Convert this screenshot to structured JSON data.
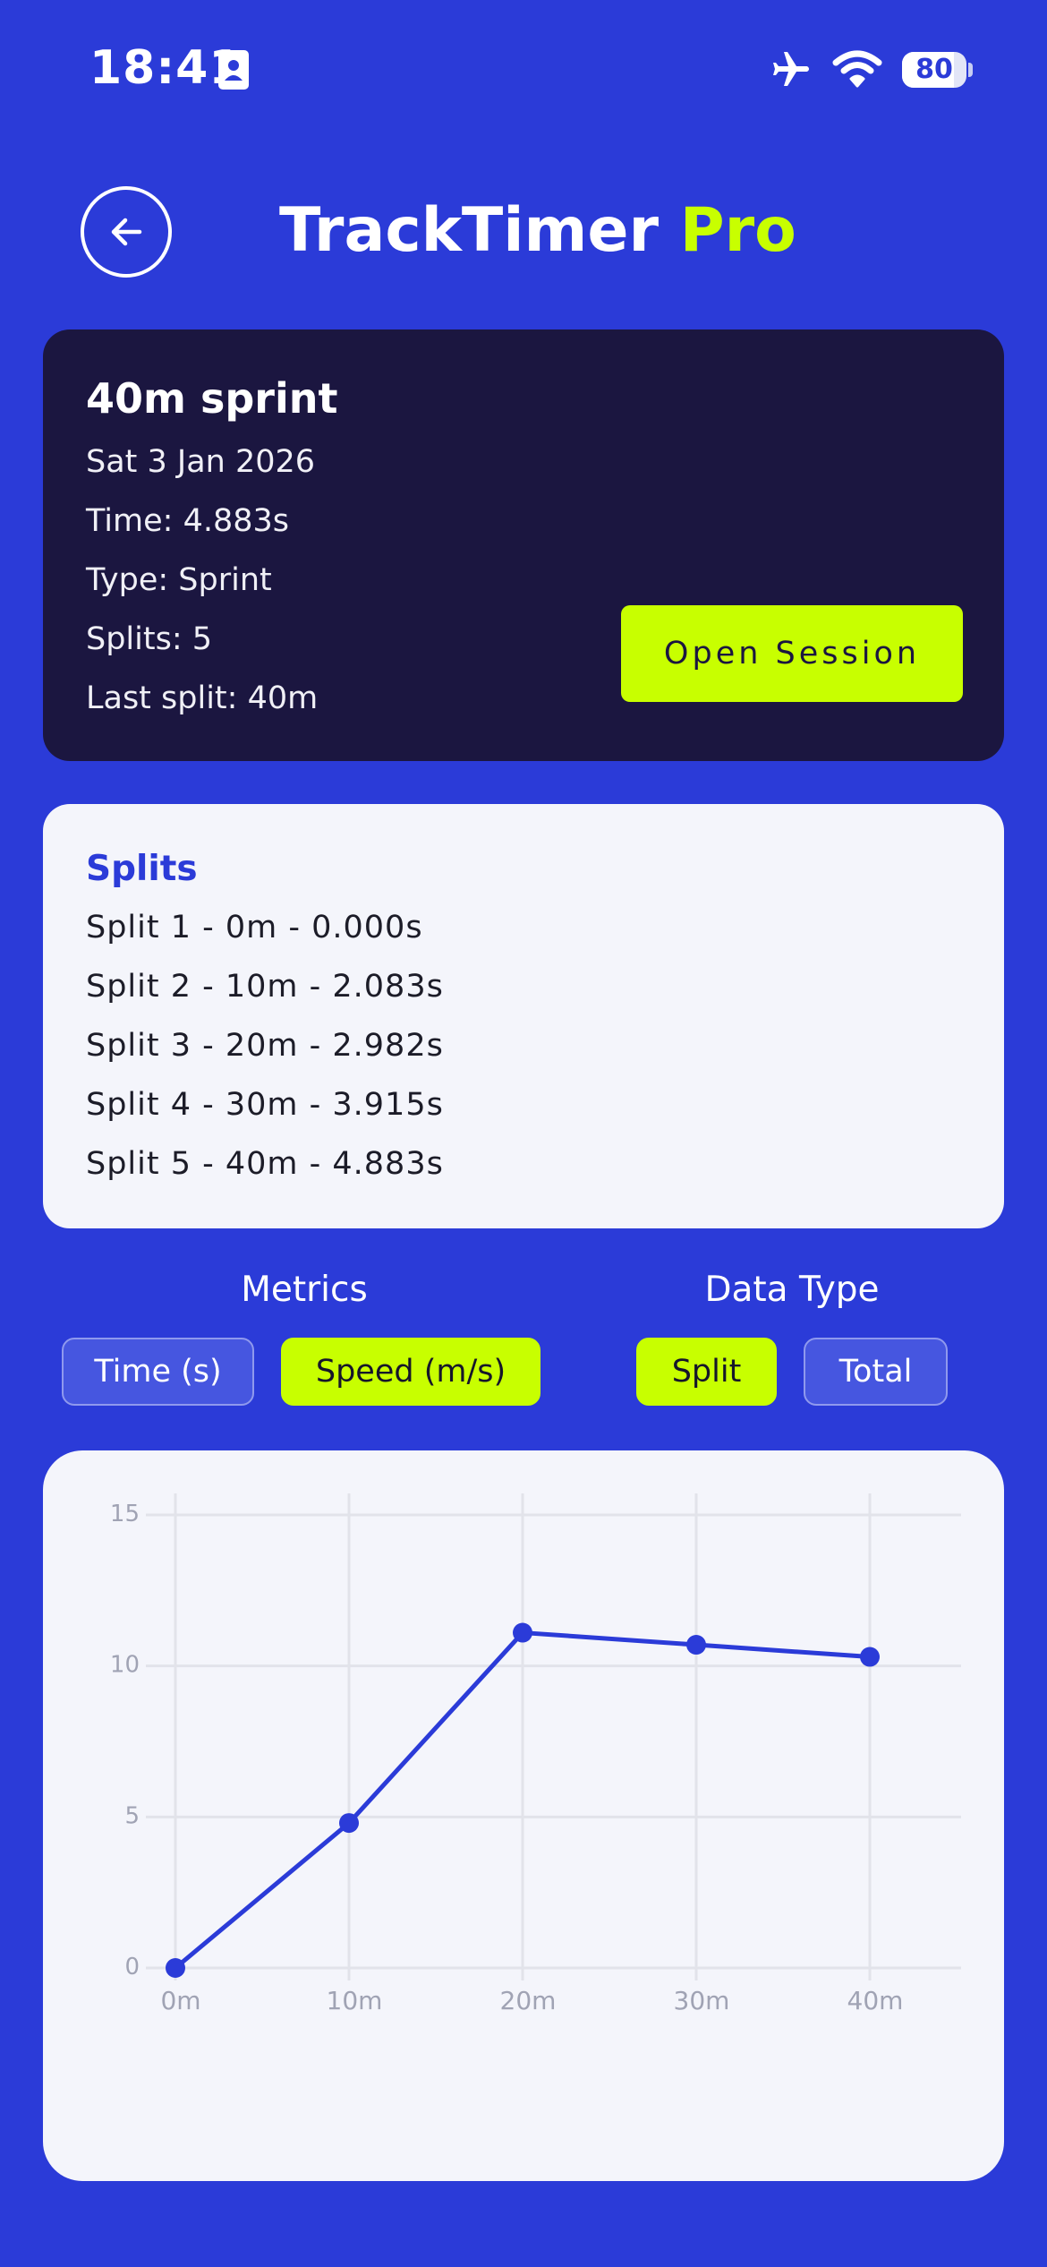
{
  "status_bar": {
    "time": "18:41",
    "battery_level": "80",
    "battery_fraction": 0.8,
    "icons": [
      "contact-card-icon",
      "airplane-icon",
      "wifi-icon",
      "battery-icon"
    ]
  },
  "header": {
    "title_main": "TrackTimer",
    "title_accent": "Pro",
    "back_icon": "arrow-left-icon"
  },
  "session": {
    "title": "40m sprint",
    "date": "Sat 3 Jan 2026",
    "time": "Time: 4.883s",
    "type": "Type: Sprint",
    "splits": "Splits: 5",
    "last_split": "Last split: 40m",
    "open_label": "Open Session"
  },
  "splits": {
    "title": "Splits",
    "items": [
      "Split 1 - 0m - 0.000s",
      "Split 2 - 10m - 2.083s",
      "Split 3 - 20m - 2.982s",
      "Split 4 - 30m - 3.915s",
      "Split 5 - 40m - 4.883s"
    ]
  },
  "controls": {
    "metrics_label": "Metrics",
    "metrics_options": [
      "Time (s)",
      "Speed (m/s)"
    ],
    "metrics_selected": "Speed (m/s)",
    "data_type_label": "Data Type",
    "data_type_options": [
      "Split",
      "Total"
    ],
    "data_type_selected": "Split"
  },
  "colors": {
    "background": "#2b3bd8",
    "accent": "#c8ff00",
    "card_dark": "#1b1640",
    "card_light": "#f4f5fb",
    "line": "#2b3bd8"
  },
  "chart_data": {
    "type": "line",
    "categories": [
      "0m",
      "10m",
      "20m",
      "30m",
      "40m"
    ],
    "series": [
      {
        "values": [
          0,
          4.8,
          11.1,
          10.7,
          10.3
        ]
      }
    ],
    "yticks": [
      "0",
      "5",
      "10",
      "15"
    ],
    "ylim": [
      0,
      15
    ],
    "grid": true,
    "legend": "none"
  }
}
